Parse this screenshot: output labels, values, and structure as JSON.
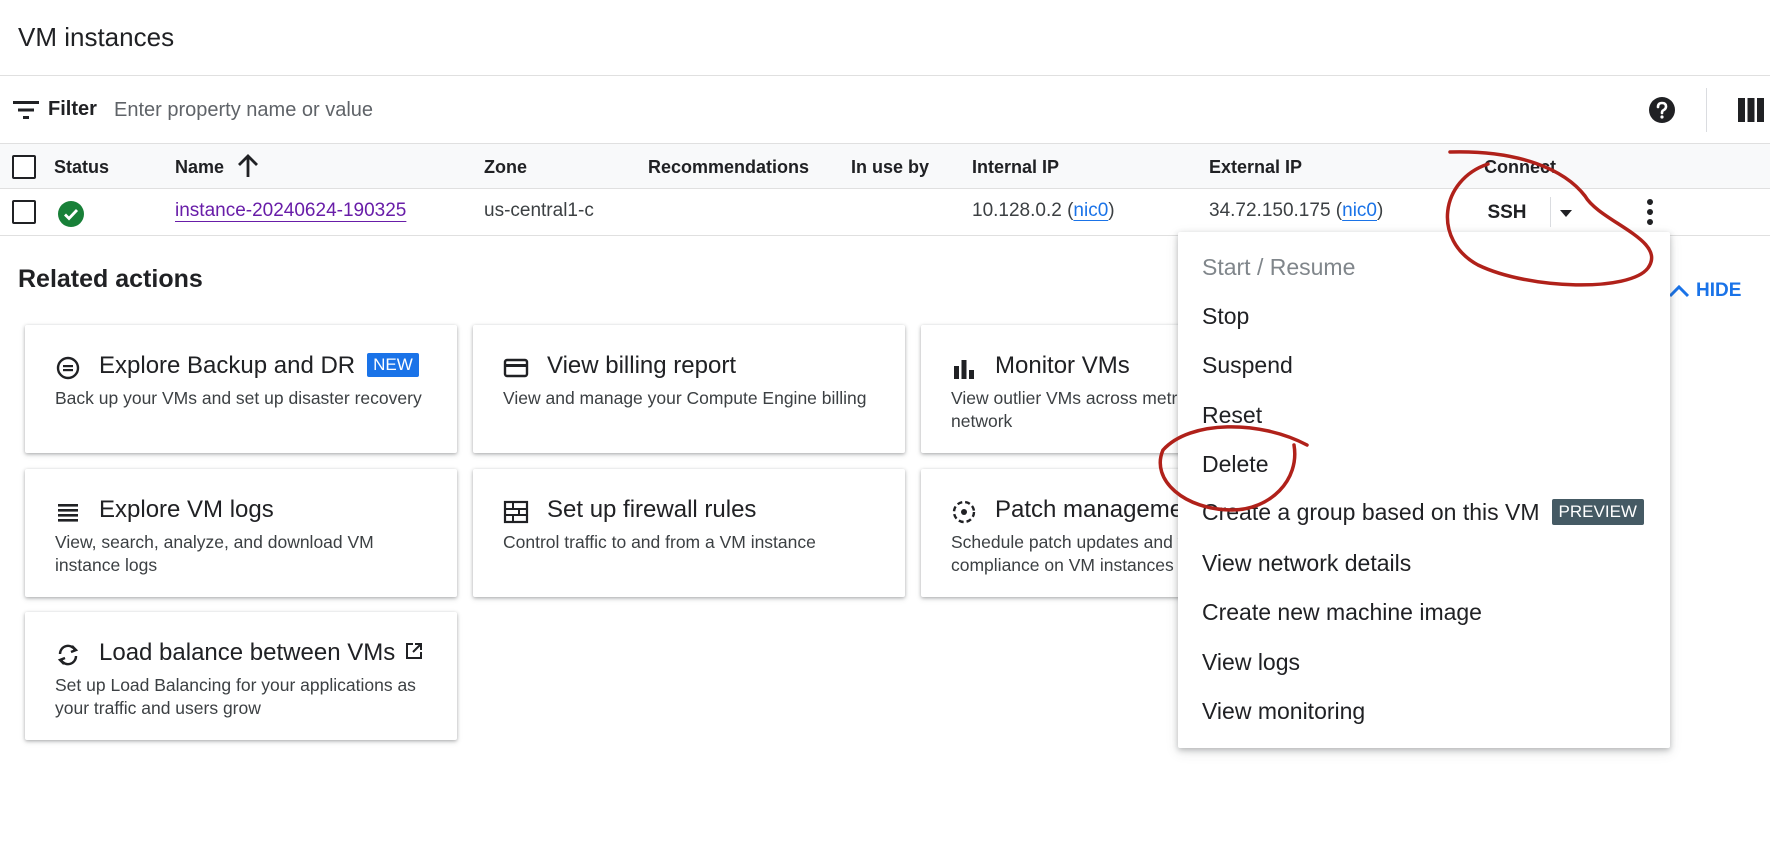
{
  "page": {
    "title": "VM instances"
  },
  "filter": {
    "label": "Filter",
    "placeholder": "Enter property name or value"
  },
  "table": {
    "columns": [
      "Status",
      "Name",
      "Zone",
      "Recommendations",
      "In use by",
      "Internal IP",
      "External IP",
      "Connect"
    ],
    "rows": [
      {
        "name": "instance-20240624-190325",
        "zone": "us-central1-c",
        "internal_ip": "10.128.0.2 (",
        "internal_nic": "nic0",
        "internal_close": ")",
        "external_ip": "34.72.150.175 (",
        "external_nic": "nic0",
        "external_close": ")",
        "connect_label": "SSH"
      }
    ]
  },
  "related": {
    "title": "Related actions",
    "hide_label": "HIDE",
    "cards": [
      {
        "title": "Explore Backup and DR",
        "badge": "NEW",
        "desc": "Back up your VMs and set up disaster recovery",
        "icon": "backup-icon"
      },
      {
        "title": "View billing report",
        "desc": "View and manage your Compute Engine billing",
        "icon": "credit-card-icon"
      },
      {
        "title": "Monitor VMs",
        "desc": "View outlier VMs across metrics like CPU and network",
        "icon": "bar-chart-icon"
      },
      {
        "title": "Explore VM logs",
        "desc": "View, search, analyze, and download VM instance logs",
        "icon": "logs-icon"
      },
      {
        "title": "Set up firewall rules",
        "desc": "Control traffic to and from a VM instance",
        "icon": "firewall-icon"
      },
      {
        "title": "Patch management",
        "desc": "Schedule patch updates and view patch compliance on VM instances",
        "icon": "patch-icon"
      },
      {
        "title": "Load balance between VMs",
        "desc": "Set up Load Balancing for your applications as your traffic and users grow",
        "icon": "sync-icon"
      }
    ]
  },
  "menu": {
    "items": [
      {
        "label": "Start / Resume",
        "disabled": true
      },
      {
        "label": "Stop"
      },
      {
        "label": "Suspend"
      },
      {
        "label": "Reset"
      },
      {
        "label": "Delete"
      },
      {
        "label": "Create a group based on this VM",
        "badge": "PREVIEW"
      },
      {
        "label": "View network details"
      },
      {
        "label": "Create new machine image"
      },
      {
        "label": "View logs"
      },
      {
        "label": "View monitoring"
      }
    ]
  },
  "colors": {
    "link": "#1a73e8",
    "visited_link": "#681da8",
    "status_ok": "#188038",
    "annotation": "#b0211a",
    "preview_badge": "#455a64"
  }
}
